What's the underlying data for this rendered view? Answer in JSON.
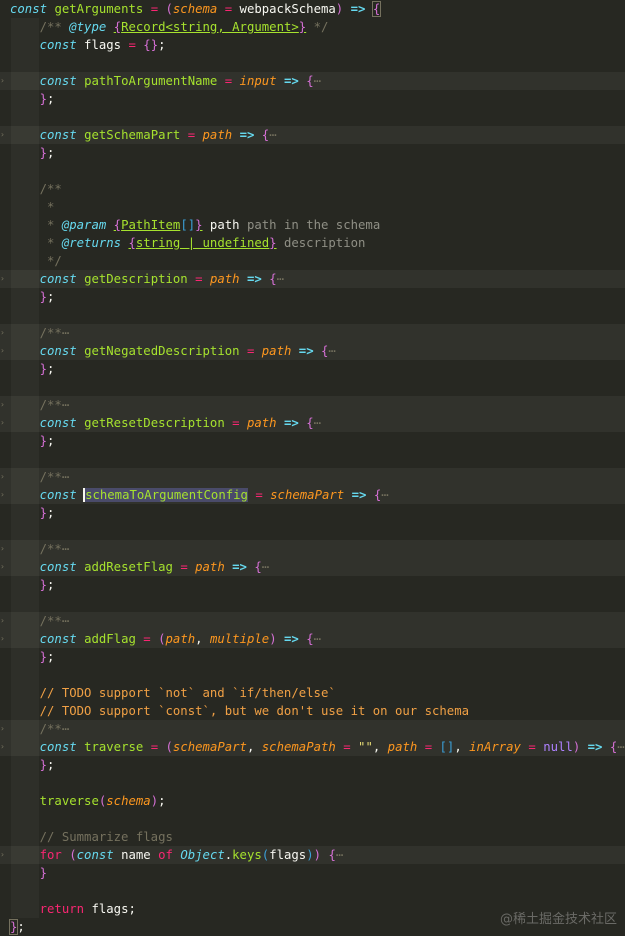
{
  "editor": {
    "lines": [
      {
        "top": true,
        "tokens": [
          [
            "k",
            "const"
          ],
          [
            "w",
            " "
          ],
          [
            "f",
            "getArguments"
          ],
          [
            "w",
            " "
          ],
          [
            "o",
            "="
          ],
          [
            "w",
            " "
          ],
          [
            "b",
            "("
          ],
          [
            "p",
            "schema"
          ],
          [
            "w",
            " "
          ],
          [
            "o",
            "="
          ],
          [
            "w",
            " webpackSchema"
          ],
          [
            "b",
            ")"
          ],
          [
            "w",
            " "
          ],
          [
            "a",
            "=>"
          ],
          [
            "w",
            " "
          ],
          [
            "b mb",
            "{"
          ]
        ]
      },
      {
        "tokens": [
          [
            "w",
            "    "
          ],
          [
            "c",
            "/** "
          ],
          [
            "tg",
            "@type"
          ],
          [
            "w",
            " "
          ],
          [
            "tb",
            "{"
          ],
          [
            "ty",
            "Record<string, Argument>"
          ],
          [
            "tb",
            "}"
          ],
          [
            "c",
            " */"
          ]
        ]
      },
      {
        "tokens": [
          [
            "w",
            "    "
          ],
          [
            "k",
            "const"
          ],
          [
            "w",
            " flags "
          ],
          [
            "o",
            "="
          ],
          [
            "w",
            " "
          ],
          [
            "b",
            "{}"
          ],
          [
            "w",
            ";"
          ]
        ]
      },
      {
        "tokens": []
      },
      {
        "fold": true,
        "hl": true,
        "tokens": [
          [
            "w",
            "    "
          ],
          [
            "k",
            "const"
          ],
          [
            "w",
            " "
          ],
          [
            "f",
            "pathToArgumentName"
          ],
          [
            "w",
            " "
          ],
          [
            "o",
            "="
          ],
          [
            "w",
            " "
          ],
          [
            "p",
            "input"
          ],
          [
            "w",
            " "
          ],
          [
            "a",
            "=>"
          ],
          [
            "w",
            " "
          ],
          [
            "b",
            "{"
          ],
          [
            "e",
            "⋯"
          ]
        ]
      },
      {
        "tokens": [
          [
            "w",
            "    "
          ],
          [
            "b",
            "}"
          ],
          [
            "w",
            ";"
          ]
        ]
      },
      {
        "tokens": []
      },
      {
        "fold": true,
        "hl": true,
        "tokens": [
          [
            "w",
            "    "
          ],
          [
            "k",
            "const"
          ],
          [
            "w",
            " "
          ],
          [
            "f",
            "getSchemaPart"
          ],
          [
            "w",
            " "
          ],
          [
            "o",
            "="
          ],
          [
            "w",
            " "
          ],
          [
            "p",
            "path"
          ],
          [
            "w",
            " "
          ],
          [
            "a",
            "=>"
          ],
          [
            "w",
            " "
          ],
          [
            "b",
            "{"
          ],
          [
            "e",
            "⋯"
          ]
        ]
      },
      {
        "tokens": [
          [
            "w",
            "    "
          ],
          [
            "b",
            "}"
          ],
          [
            "w",
            ";"
          ]
        ]
      },
      {
        "tokens": []
      },
      {
        "tokens": [
          [
            "w",
            "    "
          ],
          [
            "c",
            "/**"
          ]
        ]
      },
      {
        "tokens": [
          [
            "w",
            "     "
          ],
          [
            "c",
            "*"
          ]
        ]
      },
      {
        "tokens": [
          [
            "w",
            "     "
          ],
          [
            "c",
            "* "
          ],
          [
            "tg",
            "@param"
          ],
          [
            "w",
            " "
          ],
          [
            "tb",
            "{"
          ],
          [
            "ty",
            "PathItem"
          ],
          [
            "bl",
            "[]"
          ],
          [
            "tb",
            "}"
          ],
          [
            "w",
            " path"
          ],
          [
            "cd",
            " path in the schema"
          ]
        ]
      },
      {
        "tokens": [
          [
            "w",
            "     "
          ],
          [
            "c",
            "* "
          ],
          [
            "tg",
            "@returns"
          ],
          [
            "w",
            " "
          ],
          [
            "tb",
            "{"
          ],
          [
            "ty",
            "string | undefined"
          ],
          [
            "tb",
            "}"
          ],
          [
            "cd",
            " description"
          ]
        ]
      },
      {
        "tokens": [
          [
            "w",
            "     "
          ],
          [
            "c",
            "*/"
          ]
        ]
      },
      {
        "fold": true,
        "hl": true,
        "tokens": [
          [
            "w",
            "    "
          ],
          [
            "k",
            "const"
          ],
          [
            "w",
            " "
          ],
          [
            "f",
            "getDescription"
          ],
          [
            "w",
            " "
          ],
          [
            "o",
            "="
          ],
          [
            "w",
            " "
          ],
          [
            "p",
            "path"
          ],
          [
            "w",
            " "
          ],
          [
            "a",
            "=>"
          ],
          [
            "w",
            " "
          ],
          [
            "b",
            "{"
          ],
          [
            "e",
            "⋯"
          ]
        ]
      },
      {
        "tokens": [
          [
            "w",
            "    "
          ],
          [
            "b",
            "}"
          ],
          [
            "w",
            ";"
          ]
        ]
      },
      {
        "tokens": []
      },
      {
        "fold": true,
        "hl": true,
        "tokens": [
          [
            "w",
            "    "
          ],
          [
            "c",
            "/**"
          ],
          [
            "e",
            "⋯"
          ]
        ]
      },
      {
        "fold": true,
        "hl": true,
        "tokens": [
          [
            "w",
            "    "
          ],
          [
            "k",
            "const"
          ],
          [
            "w",
            " "
          ],
          [
            "f",
            "getNegatedDescription"
          ],
          [
            "w",
            " "
          ],
          [
            "o",
            "="
          ],
          [
            "w",
            " "
          ],
          [
            "p",
            "path"
          ],
          [
            "w",
            " "
          ],
          [
            "a",
            "=>"
          ],
          [
            "w",
            " "
          ],
          [
            "b",
            "{"
          ],
          [
            "e",
            "⋯"
          ]
        ]
      },
      {
        "tokens": [
          [
            "w",
            "    "
          ],
          [
            "b",
            "}"
          ],
          [
            "w",
            ";"
          ]
        ]
      },
      {
        "tokens": []
      },
      {
        "fold": true,
        "hl": true,
        "tokens": [
          [
            "w",
            "    "
          ],
          [
            "c",
            "/**"
          ],
          [
            "e",
            "⋯"
          ]
        ]
      },
      {
        "fold": true,
        "hl": true,
        "tokens": [
          [
            "w",
            "    "
          ],
          [
            "k",
            "const"
          ],
          [
            "w",
            " "
          ],
          [
            "f",
            "getResetDescription"
          ],
          [
            "w",
            " "
          ],
          [
            "o",
            "="
          ],
          [
            "w",
            " "
          ],
          [
            "p",
            "path"
          ],
          [
            "w",
            " "
          ],
          [
            "a",
            "=>"
          ],
          [
            "w",
            " "
          ],
          [
            "b",
            "{"
          ],
          [
            "e",
            "⋯"
          ]
        ]
      },
      {
        "tokens": [
          [
            "w",
            "    "
          ],
          [
            "b",
            "}"
          ],
          [
            "w",
            ";"
          ]
        ]
      },
      {
        "tokens": []
      },
      {
        "fold": true,
        "hl": true,
        "tokens": [
          [
            "w",
            "    "
          ],
          [
            "c",
            "/**"
          ],
          [
            "e",
            "⋯"
          ]
        ]
      },
      {
        "fold": true,
        "hl": true,
        "tokens": [
          [
            "w",
            "    "
          ],
          [
            "k",
            "const"
          ],
          [
            "w",
            " "
          ],
          [
            "sel cur",
            "schemaToArgumentConfig"
          ],
          [
            "w",
            " "
          ],
          [
            "o",
            "="
          ],
          [
            "w",
            " "
          ],
          [
            "p",
            "schemaPart"
          ],
          [
            "w",
            " "
          ],
          [
            "a",
            "=>"
          ],
          [
            "w",
            " "
          ],
          [
            "b",
            "{"
          ],
          [
            "e",
            "⋯"
          ]
        ]
      },
      {
        "tokens": [
          [
            "w",
            "    "
          ],
          [
            "b",
            "}"
          ],
          [
            "w",
            ";"
          ]
        ]
      },
      {
        "tokens": []
      },
      {
        "fold": true,
        "hl": true,
        "tokens": [
          [
            "w",
            "    "
          ],
          [
            "c",
            "/**"
          ],
          [
            "e",
            "⋯"
          ]
        ]
      },
      {
        "fold": true,
        "hl": true,
        "tokens": [
          [
            "w",
            "    "
          ],
          [
            "k",
            "const"
          ],
          [
            "w",
            " "
          ],
          [
            "f",
            "addResetFlag"
          ],
          [
            "w",
            " "
          ],
          [
            "o",
            "="
          ],
          [
            "w",
            " "
          ],
          [
            "p",
            "path"
          ],
          [
            "w",
            " "
          ],
          [
            "a",
            "=>"
          ],
          [
            "w",
            " "
          ],
          [
            "b",
            "{"
          ],
          [
            "e",
            "⋯"
          ]
        ]
      },
      {
        "tokens": [
          [
            "w",
            "    "
          ],
          [
            "b",
            "}"
          ],
          [
            "w",
            ";"
          ]
        ]
      },
      {
        "tokens": []
      },
      {
        "fold": true,
        "hl": true,
        "tokens": [
          [
            "w",
            "    "
          ],
          [
            "c",
            "/**"
          ],
          [
            "e",
            "⋯"
          ]
        ]
      },
      {
        "fold": true,
        "hl": true,
        "tokens": [
          [
            "w",
            "    "
          ],
          [
            "k",
            "const"
          ],
          [
            "w",
            " "
          ],
          [
            "f",
            "addFlag"
          ],
          [
            "w",
            " "
          ],
          [
            "o",
            "="
          ],
          [
            "w",
            " "
          ],
          [
            "b",
            "("
          ],
          [
            "p",
            "path"
          ],
          [
            "w",
            ", "
          ],
          [
            "p",
            "multiple"
          ],
          [
            "b",
            ")"
          ],
          [
            "w",
            " "
          ],
          [
            "a",
            "=>"
          ],
          [
            "w",
            " "
          ],
          [
            "b",
            "{"
          ],
          [
            "e",
            "⋯"
          ]
        ]
      },
      {
        "tokens": [
          [
            "w",
            "    "
          ],
          [
            "b",
            "}"
          ],
          [
            "w",
            ";"
          ]
        ]
      },
      {
        "tokens": []
      },
      {
        "tokens": [
          [
            "w",
            "    "
          ],
          [
            "t",
            "// TODO support `not` and `if/then/else`"
          ]
        ]
      },
      {
        "tokens": [
          [
            "w",
            "    "
          ],
          [
            "t",
            "// TODO support `const`, but we don't use it on our schema"
          ]
        ]
      },
      {
        "fold": true,
        "hl": true,
        "tokens": [
          [
            "w",
            "    "
          ],
          [
            "c",
            "/**"
          ],
          [
            "e",
            "⋯"
          ]
        ]
      },
      {
        "fold": true,
        "hl": true,
        "tokens": [
          [
            "w",
            "    "
          ],
          [
            "k",
            "const"
          ],
          [
            "w",
            " "
          ],
          [
            "f",
            "traverse"
          ],
          [
            "w",
            " "
          ],
          [
            "o",
            "="
          ],
          [
            "w",
            " "
          ],
          [
            "b",
            "("
          ],
          [
            "p",
            "schemaPart"
          ],
          [
            "w",
            ", "
          ],
          [
            "p",
            "schemaPath"
          ],
          [
            "w",
            " "
          ],
          [
            "o",
            "="
          ],
          [
            "w",
            " "
          ],
          [
            "s",
            "\"\""
          ],
          [
            "w",
            ", "
          ],
          [
            "p",
            "path"
          ],
          [
            "w",
            " "
          ],
          [
            "o",
            "="
          ],
          [
            "w",
            " "
          ],
          [
            "bl",
            "[]"
          ],
          [
            "w",
            ", "
          ],
          [
            "p",
            "inArray"
          ],
          [
            "w",
            " "
          ],
          [
            "o",
            "="
          ],
          [
            "w",
            " "
          ],
          [
            "n",
            "null"
          ],
          [
            "b",
            ")"
          ],
          [
            "w",
            " "
          ],
          [
            "a",
            "=>"
          ],
          [
            "w",
            " "
          ],
          [
            "b",
            "{"
          ],
          [
            "e",
            "⋯"
          ]
        ]
      },
      {
        "tokens": [
          [
            "w",
            "    "
          ],
          [
            "b",
            "}"
          ],
          [
            "w",
            ";"
          ]
        ]
      },
      {
        "tokens": []
      },
      {
        "tokens": [
          [
            "w",
            "    "
          ],
          [
            "f",
            "traverse"
          ],
          [
            "b",
            "("
          ],
          [
            "p",
            "schema"
          ],
          [
            "b",
            ")"
          ],
          [
            "w",
            ";"
          ]
        ]
      },
      {
        "tokens": []
      },
      {
        "tokens": [
          [
            "w",
            "    "
          ],
          [
            "c",
            "// Summarize flags"
          ]
        ]
      },
      {
        "fold": true,
        "hl": true,
        "tokens": [
          [
            "w",
            "    "
          ],
          [
            "r",
            "for"
          ],
          [
            "w",
            " "
          ],
          [
            "b",
            "("
          ],
          [
            "k",
            "const"
          ],
          [
            "w",
            " name "
          ],
          [
            "r",
            "of"
          ],
          [
            "w",
            " "
          ],
          [
            "cl",
            "Object"
          ],
          [
            "w",
            "."
          ],
          [
            "f",
            "keys"
          ],
          [
            "bl",
            "("
          ],
          [
            "w",
            "flags"
          ],
          [
            "bl",
            ")"
          ],
          [
            "b",
            ")"
          ],
          [
            "w",
            " "
          ],
          [
            "b",
            "{"
          ],
          [
            "e",
            "⋯"
          ]
        ]
      },
      {
        "tokens": [
          [
            "w",
            "    "
          ],
          [
            "b",
            "}"
          ]
        ]
      },
      {
        "tokens": []
      },
      {
        "tokens": [
          [
            "w",
            "    "
          ],
          [
            "r",
            "return"
          ],
          [
            "w",
            " flags;"
          ]
        ]
      },
      {
        "top": true,
        "tokens": [
          [
            "b mb",
            "}"
          ],
          [
            "w",
            ";"
          ]
        ]
      }
    ]
  },
  "watermark": "@稀土掘金技术社区"
}
